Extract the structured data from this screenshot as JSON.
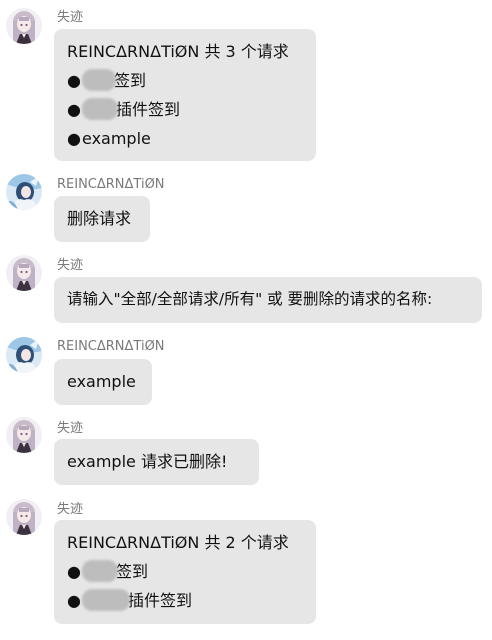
{
  "messages": [
    {
      "sender": "失迹",
      "lines": [
        {
          "text": "REINCΔRNΔTiØN 共 3 个请求"
        },
        {
          "bullet": "●",
          "text": "签到"
        },
        {
          "bullet": "●",
          "text": "插件签到"
        },
        {
          "bullet": "●",
          "text": "example"
        }
      ]
    },
    {
      "sender": "REINCΔRNΔTiØN",
      "lines": [
        {
          "text": "删除请求"
        }
      ]
    },
    {
      "sender": "失迹",
      "lines": [
        {
          "text": "请输入\"全部/全部请求/所有\" 或 要删除的请求的名称:"
        }
      ]
    },
    {
      "sender": "REINCΔRNΔTiØN",
      "lines": [
        {
          "text": "example"
        }
      ]
    },
    {
      "sender": "失迹",
      "lines": [
        {
          "text": "example 请求已删除!"
        }
      ]
    },
    {
      "sender": "失迹",
      "lines": [
        {
          "text": "REINCΔRNΔTiØN 共 2 个请求"
        },
        {
          "bullet": "●",
          "text": "签到"
        },
        {
          "bullet": "●",
          "text": "插件签到"
        }
      ]
    }
  ]
}
